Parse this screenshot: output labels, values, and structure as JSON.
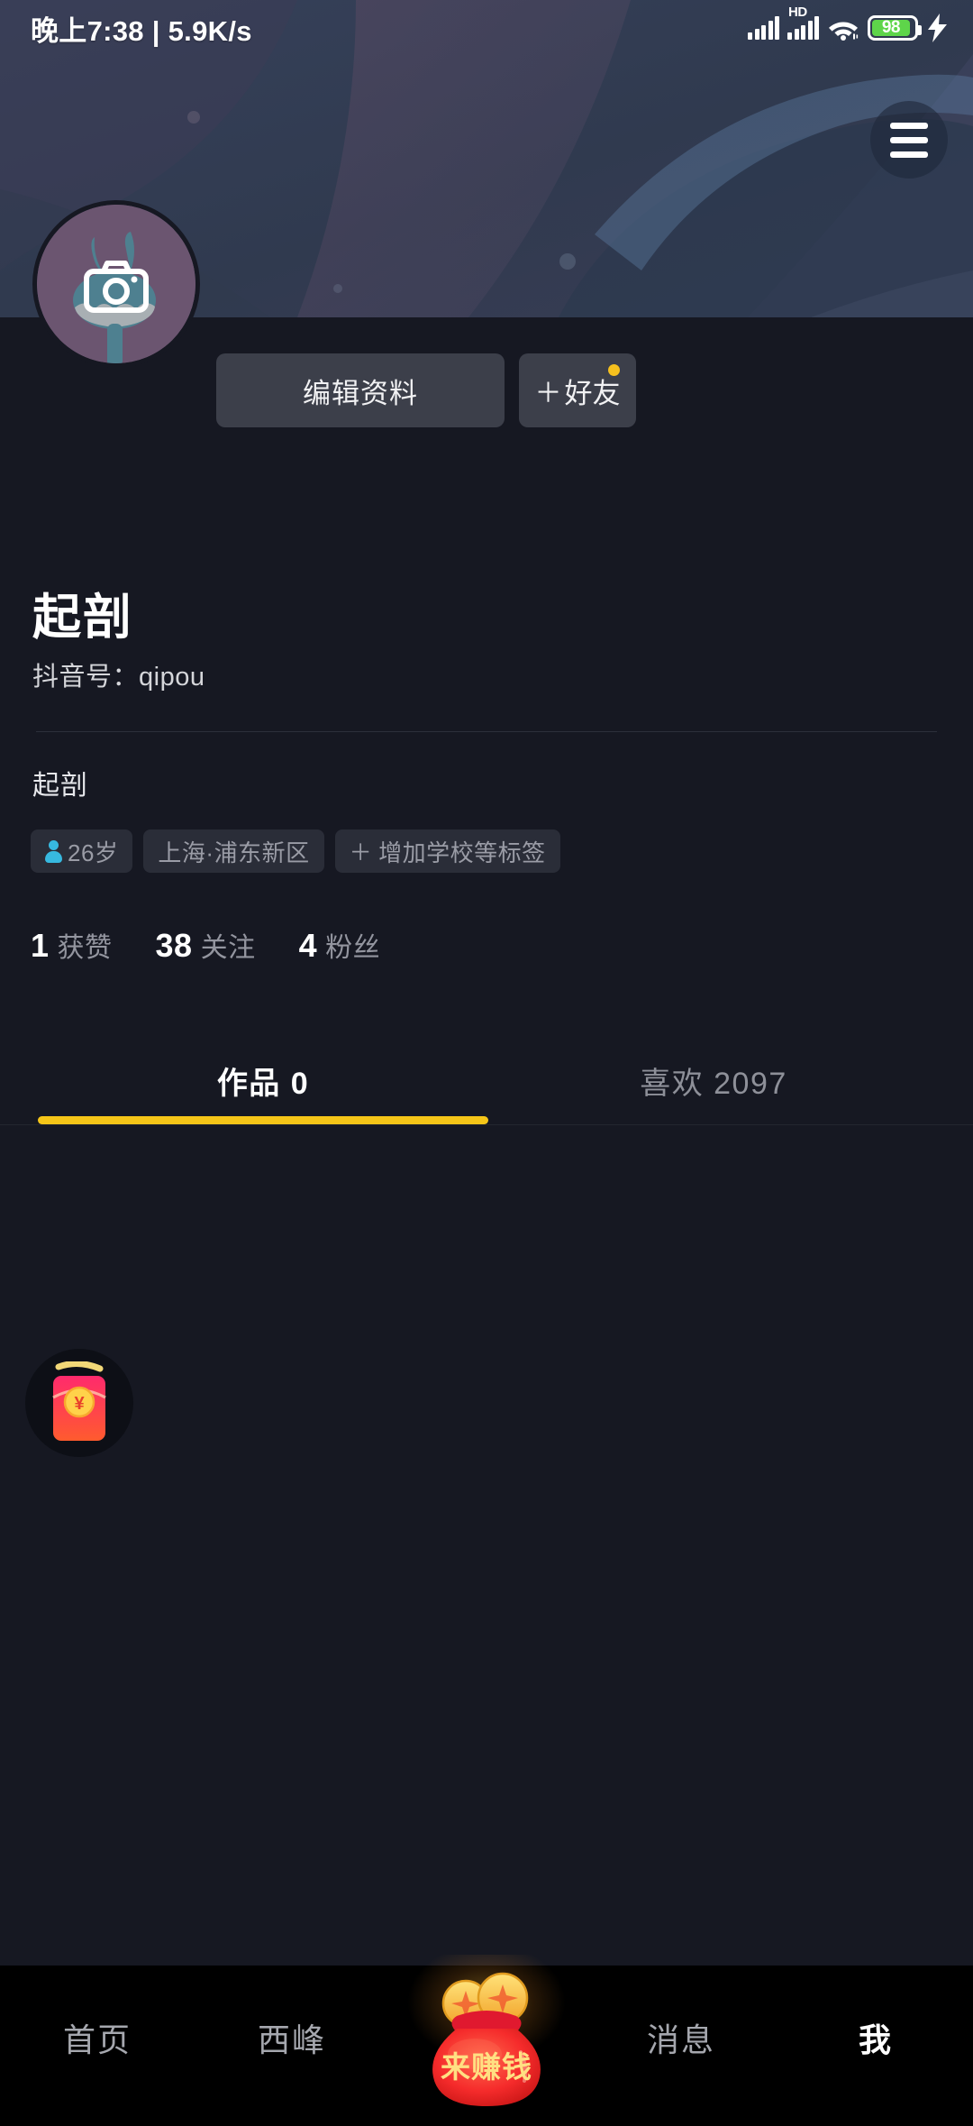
{
  "statusbar": {
    "time_text": "晚上7:38 | 5.9K/s",
    "hd_label": "HD",
    "battery_level": "98",
    "icons": [
      "signal-icon",
      "hd-signal-icon",
      "wifi-icon",
      "battery-icon",
      "charging-bolt-icon"
    ]
  },
  "header": {
    "menu_icon": "hamburger-menu-icon",
    "avatar_camera_icon": "camera-icon"
  },
  "actions": {
    "edit_profile_label": "编辑资料",
    "add_friend_plus": "＋",
    "add_friend_label": "好友",
    "badge_color": "#f5c01e"
  },
  "profile": {
    "nickname": "起剖",
    "douyin_id": "抖音号：qipou",
    "bio": "起剖",
    "tags": [
      {
        "icon": "person-icon",
        "label": "26岁"
      },
      {
        "icon": "",
        "label": "上海·浦东新区"
      },
      {
        "icon": "plus",
        "label": "增加学校等标签"
      }
    ],
    "stats": [
      {
        "value": "1",
        "label": "获赞"
      },
      {
        "value": "38",
        "label": "关注"
      },
      {
        "value": "4",
        "label": "粉丝"
      }
    ]
  },
  "tabs": {
    "works_label": "作品 0",
    "likes_label": "喜欢 2097",
    "active_index": 0,
    "accent_color": "#f5c518"
  },
  "floating": {
    "red_packet_icon": "red-packet-icon"
  },
  "bottomnav": {
    "items": [
      {
        "label": "首页",
        "active": false
      },
      {
        "label": "西峰",
        "active": false
      },
      {
        "label": "来赚钱",
        "active": false,
        "icon": "money-bag-icon"
      },
      {
        "label": "消息",
        "active": false
      },
      {
        "label": "我",
        "active": true
      }
    ]
  },
  "colors": {
    "page_bg": "#161822",
    "banner_bg": "#313c51",
    "button_bg": "#3c3f4a",
    "accent_yellow": "#f5c518",
    "nav_bg": "#000000"
  }
}
